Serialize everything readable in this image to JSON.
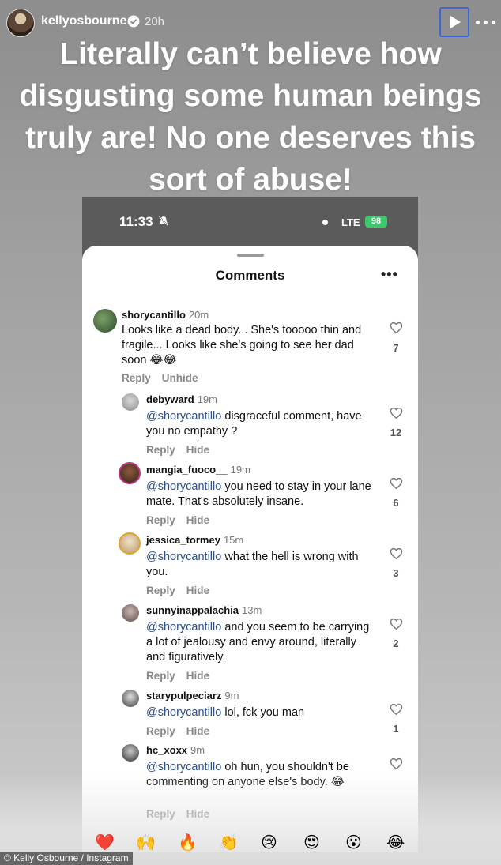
{
  "story": {
    "username": "kellyosbourne",
    "time": "20h",
    "caption": "Literally can’t believe how disgusting some human beings truly are! No one deserves this sort of abuse!"
  },
  "phone": {
    "status_time": "11:33",
    "network": "LTE",
    "battery": "98"
  },
  "sheet": {
    "title": "Comments",
    "more": "•••"
  },
  "comments": [
    {
      "user": "shorycantillo",
      "time": "20m",
      "text": "Looks like a dead body... She's tooooo thin and fragile... Looks like she's going to see her dad soon 😂😂",
      "actions": [
        "Reply",
        "Unhide"
      ],
      "likes": "7"
    },
    {
      "user": "debyward",
      "time": "19m",
      "mention": "@shorycantillo",
      "text": "disgraceful comment, have you no empathy ?",
      "actions": [
        "Reply",
        "Hide"
      ],
      "likes": "12"
    },
    {
      "user": "mangia_fuoco__",
      "time": "19m",
      "mention": "@shorycantillo",
      "text": "you need to stay in your lane mate. That's absolutely insane.",
      "actions": [
        "Reply",
        "Hide"
      ],
      "likes": "6"
    },
    {
      "user": "jessica_tormey",
      "time": "15m",
      "mention": "@shorycantillo",
      "text": "what the hell is wrong with you.",
      "actions": [
        "Reply",
        "Hide"
      ],
      "likes": "3"
    },
    {
      "user": "sunnyinappalachia",
      "time": "13m",
      "mention": "@shorycantillo",
      "text": "and you seem to be carrying a lot of jealousy and envy around, literally and figuratively.",
      "actions": [
        "Reply",
        "Hide"
      ],
      "likes": "2"
    },
    {
      "user": "starypulpeciarz",
      "time": "9m",
      "mention": "@shorycantillo",
      "text": "lol, fck you man",
      "actions": [
        "Reply",
        "Hide"
      ],
      "likes": "1"
    },
    {
      "user": "hc_xoxx",
      "time": "9m",
      "mention": "@shorycantillo",
      "text": "oh hun, you shouldn't be commenting on anyone else's body. 😂",
      "actions": [
        "Reply",
        "Hide"
      ],
      "likes": ""
    }
  ],
  "reactions": [
    "❤️",
    "🙌",
    "🔥",
    "👏",
    "😢",
    "😍",
    "😮",
    "😂"
  ],
  "credit": "© Kelly Osbourne / Instagram",
  "colors": {
    "mention": "#2c4f8d",
    "battery": "#3ec76c",
    "play_border": "#3d66d6"
  }
}
